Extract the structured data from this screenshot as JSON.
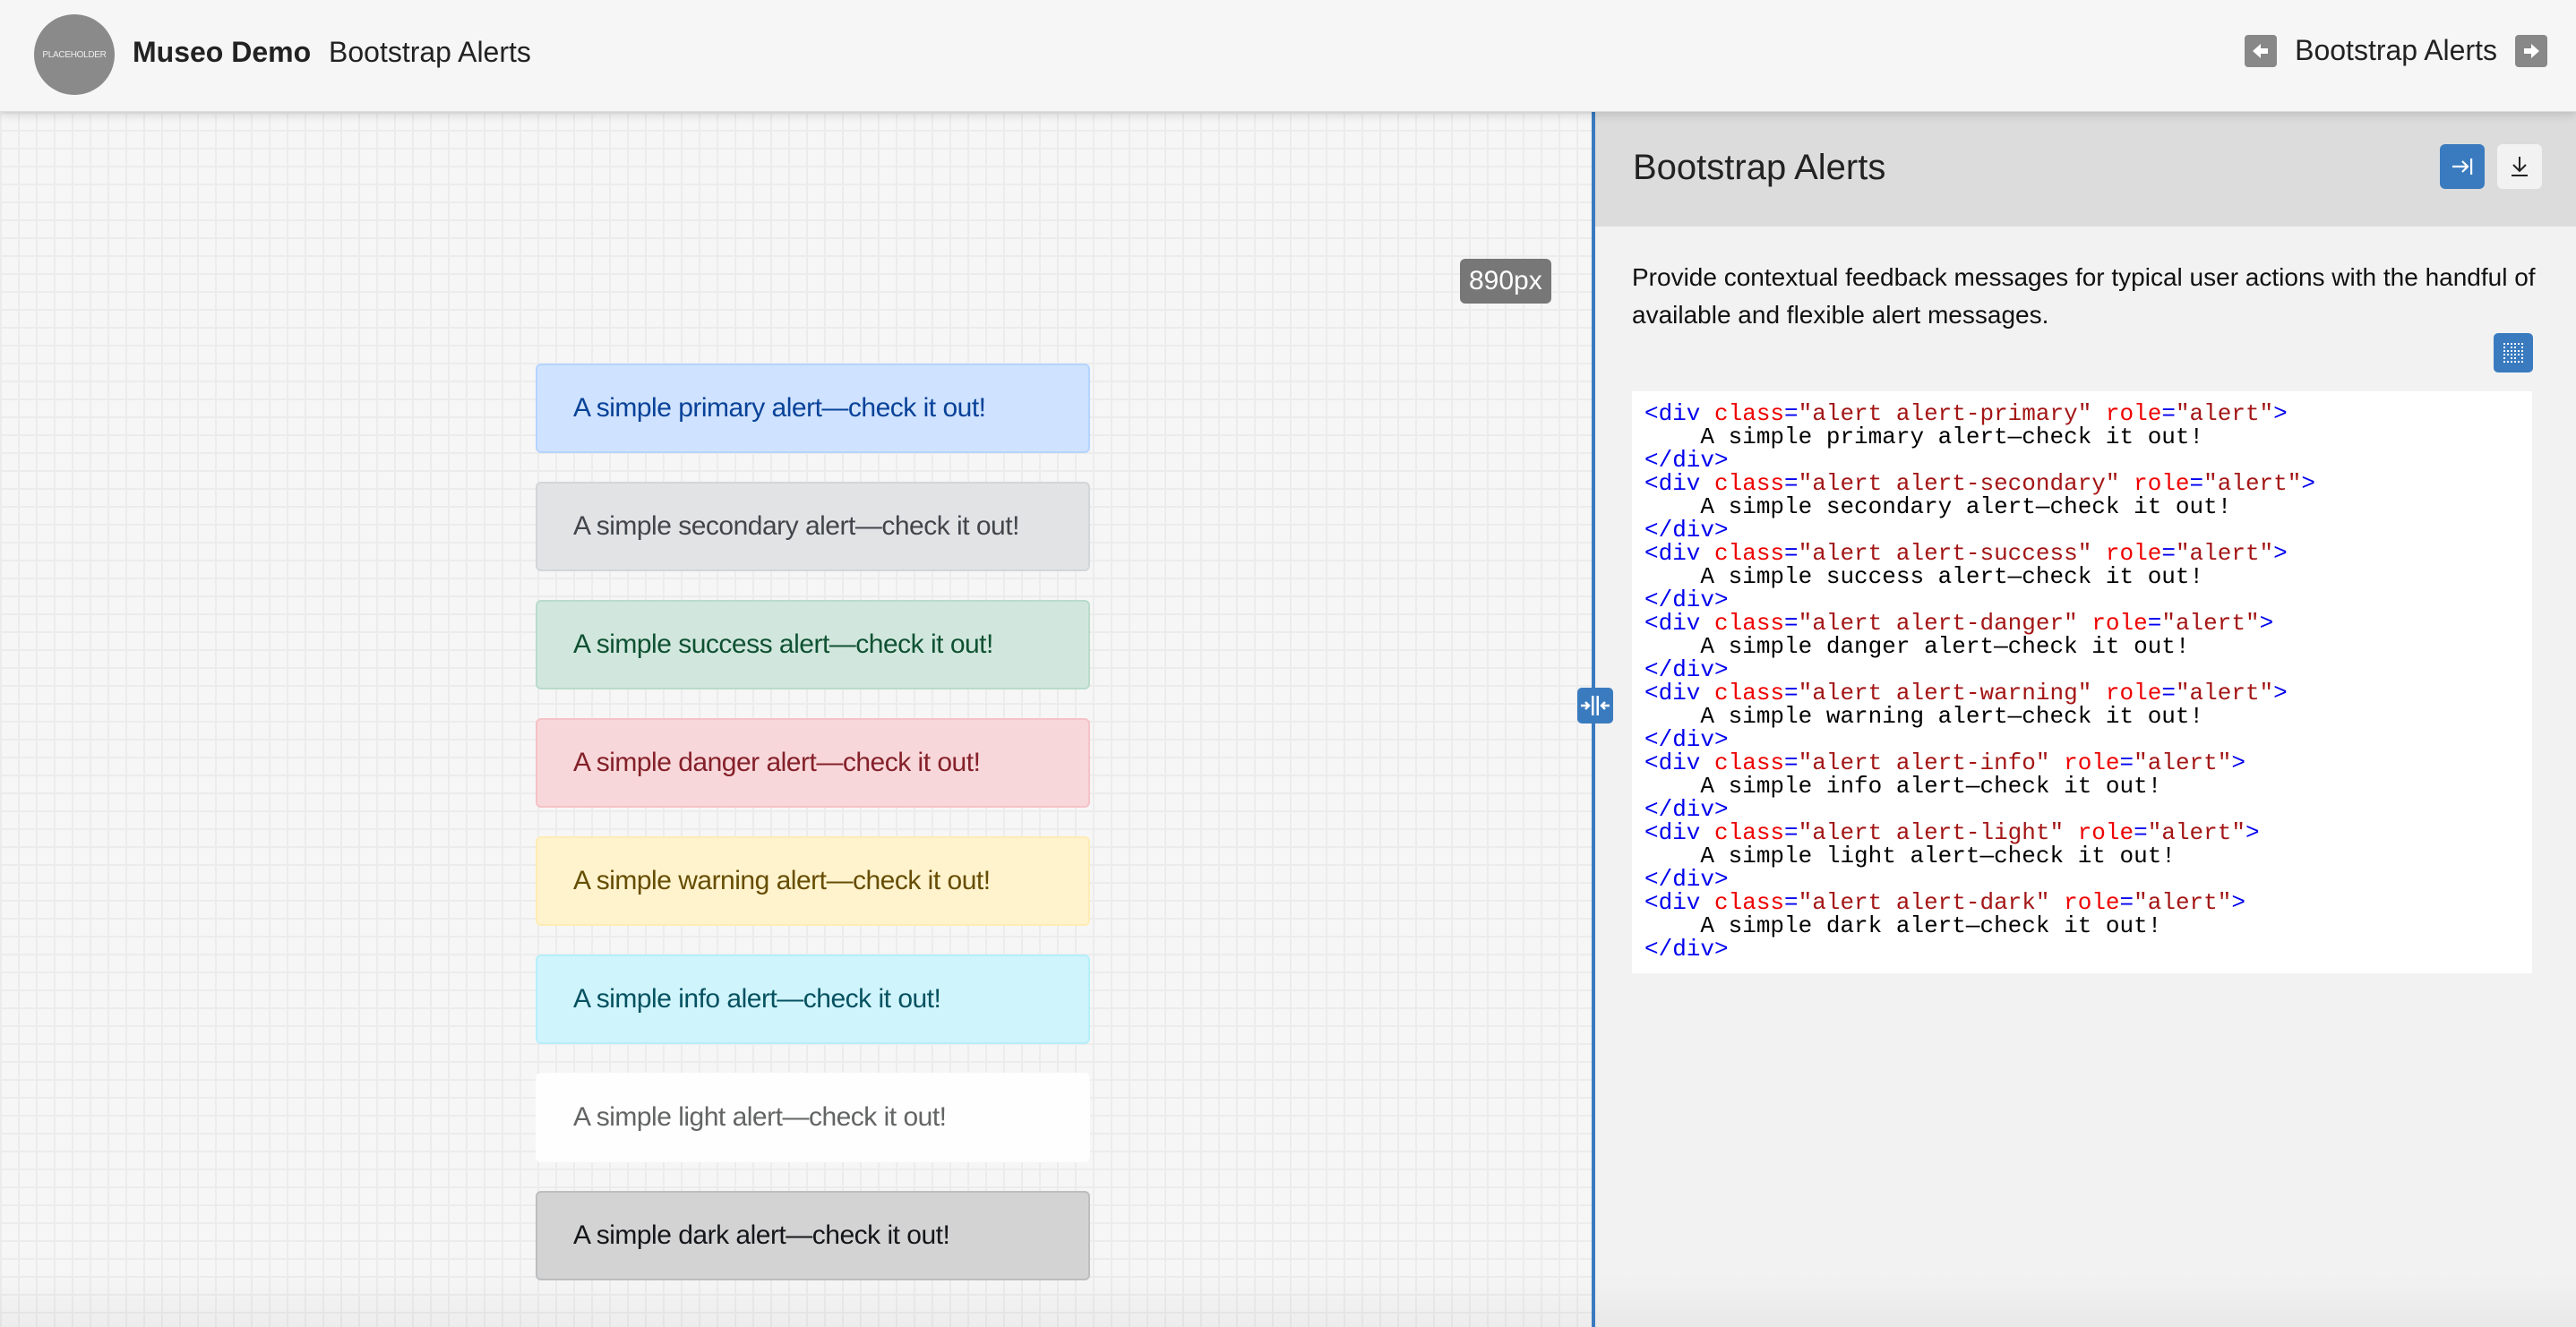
{
  "header": {
    "logo_text": "PLACEHOLDER",
    "brand": "Museo Demo",
    "page_name": "Bootstrap Alerts",
    "nav_title": "Bootstrap Alerts",
    "prev_icon": "arrow-left-icon",
    "next_icon": "arrow-right-icon"
  },
  "canvas": {
    "width_badge": "890px",
    "alerts": [
      {
        "variant": "primary",
        "text": "A simple primary alert—check it out!",
        "bg": "#cfe2ff",
        "border": "#b6d4fe",
        "color": "#084298"
      },
      {
        "variant": "secondary",
        "text": "A simple secondary alert—check it out!",
        "bg": "#e2e3e5",
        "border": "#d3d6d8",
        "color": "#41464b"
      },
      {
        "variant": "success",
        "text": "A simple success alert—check it out!",
        "bg": "#d1e7dd",
        "border": "#badbcc",
        "color": "#0f5132"
      },
      {
        "variant": "danger",
        "text": "A simple danger alert—check it out!",
        "bg": "#f8d7da",
        "border": "#f5c2c7",
        "color": "#842029"
      },
      {
        "variant": "warning",
        "text": "A simple warning alert—check it out!",
        "bg": "#fff3cd",
        "border": "#ffecb5",
        "color": "#664d03"
      },
      {
        "variant": "info",
        "text": "A simple info alert—check it out!",
        "bg": "#cff4fc",
        "border": "#b6effb",
        "color": "#055160"
      },
      {
        "variant": "light",
        "text": "A simple light alert—check it out!",
        "bg": "#fefefe",
        "border": "#fdfdfe",
        "color": "#636464"
      },
      {
        "variant": "dark",
        "text": "A simple dark alert—check it out!",
        "bg": "#d3d3d4",
        "border": "#bcbebf",
        "color": "#141619"
      }
    ]
  },
  "panel": {
    "title": "Bootstrap Alerts",
    "collapse_icon": "collapse-panel-icon",
    "download_icon": "download-icon",
    "description": "Provide contextual feedback messages for typical user actions with the handful of available and flexible alert messages.",
    "grid_icon": "grid-toggle-icon",
    "code_lines": [
      {
        "variant": "primary",
        "text": "A simple primary alert—check it out!"
      },
      {
        "variant": "secondary",
        "text": "A simple secondary alert—check it out!"
      },
      {
        "variant": "success",
        "text": "A simple success alert—check it out!"
      },
      {
        "variant": "danger",
        "text": "A simple danger alert—check it out!"
      },
      {
        "variant": "warning",
        "text": "A simple warning alert—check it out!"
      },
      {
        "variant": "info",
        "text": "A simple info alert—check it out!"
      },
      {
        "variant": "light",
        "text": "A simple light alert—check it out!"
      },
      {
        "variant": "dark",
        "text": "A simple dark alert—check it out!"
      }
    ]
  },
  "colors": {
    "accent": "#3a7bbf",
    "nav_button": "#888888",
    "badge": "#777777"
  }
}
